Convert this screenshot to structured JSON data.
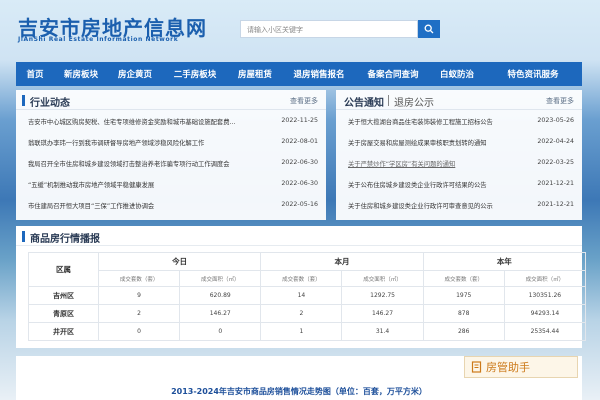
{
  "header": {
    "site_title": "吉安市房地产信息网",
    "site_subtitle": "JiAnShi Real Estate Information Network",
    "search_placeholder": "请输入小区关键字"
  },
  "nav": {
    "items": [
      "首页",
      "新房板块",
      "房企黄页",
      "二手房板块",
      "房屋租赁",
      "退房销售报名",
      "备案合同查询",
      "白蚁防治",
      "特色资讯服务"
    ]
  },
  "news": {
    "title": "行业动态",
    "more": "查看更多",
    "items": [
      {
        "text": "吉安市中心城区购房契税、住宅专项维修资金奖励和城市基础设施配套费...",
        "date": "2022-11-25"
      },
      {
        "text": "翁联琪办李玮一行到我市调研督导房地产领域涉稳风险化解工作",
        "date": "2022-08-01"
      },
      {
        "text": "我局召开全市住房和城乡建设领域打击整治养老诈骗专项行动工作调度会",
        "date": "2022-06-30"
      },
      {
        "text": "“五缓”机制推动我市房地产领域平稳健康发展",
        "date": "2022-06-30"
      },
      {
        "text": "市住建局召开恒大项目“三保”工作推进协调会",
        "date": "2022-05-16"
      }
    ]
  },
  "notice": {
    "tab_active": "公告通知",
    "tab_inactive": "退房公示",
    "more": "查看更多",
    "items": [
      {
        "text": "关于恒大揽湖台商品住宅装饰装修工程施工招标公告",
        "date": "2023-05-26"
      },
      {
        "text": "关于房屋交易和房屋测绘成果审核职责划转的通知",
        "date": "2022-04-24"
      },
      {
        "text": "关于严禁炒作“学区房”有关问题的通知",
        "date": "2022-03-25"
      },
      {
        "text": "关于公布住房城乡建设类企业行政许可结果的公告",
        "date": "2021-12-21"
      },
      {
        "text": "关于住房和城乡建设类企业行政许可审查意见的公示",
        "date": "2021-12-21"
      }
    ]
  },
  "stats": {
    "title": "商品房行情播报",
    "col_region": "区属",
    "periods": [
      "今日",
      "本月",
      "本年"
    ],
    "sub_headers": [
      "成交套数（套）",
      "成交面积（㎡）"
    ],
    "rows": [
      {
        "region": "吉州区",
        "values": [
          "9",
          "620.89",
          "14",
          "1292.75",
          "1975",
          "130351.26"
        ]
      },
      {
        "region": "青原区",
        "values": [
          "2",
          "146.27",
          "2",
          "146.27",
          "878",
          "94293.14"
        ]
      },
      {
        "region": "井开区",
        "values": [
          "0",
          "0",
          "1",
          "31.4",
          "286",
          "25354.44"
        ]
      }
    ]
  },
  "chart_section": {
    "title": "2013-2024年吉安市商品房销售情况走势图（单位：百套，万平方米）"
  },
  "badge": {
    "text": "房管助手"
  },
  "colors": {
    "brand_blue": "#1d68bd",
    "nav_text": "#ffffff"
  }
}
